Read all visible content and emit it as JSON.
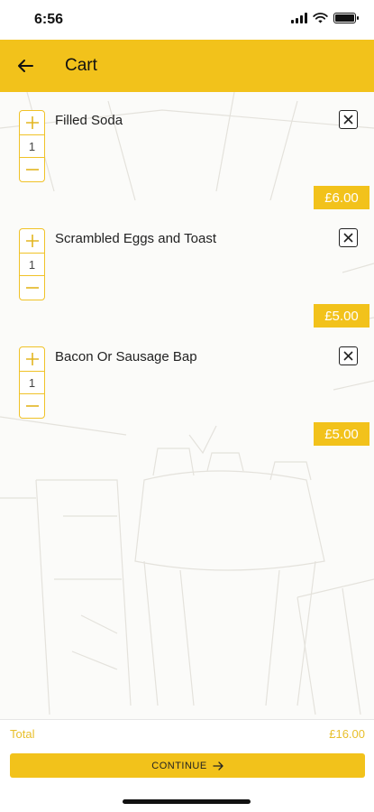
{
  "status_bar": {
    "time": "6:56"
  },
  "header": {
    "title": "Cart"
  },
  "cart": {
    "items": [
      {
        "name": "Filled Soda",
        "quantity": "1",
        "price": "£6.00"
      },
      {
        "name": "Scrambled Eggs and Toast",
        "quantity": "1",
        "price": "£5.00"
      },
      {
        "name": "Bacon Or Sausage Bap",
        "quantity": "1",
        "price": "£5.00"
      }
    ]
  },
  "footer": {
    "total_label": "Total",
    "total_value": "£16.00",
    "continue_label": "CONTINUE"
  },
  "colors": {
    "accent": "#f2c21b",
    "stepper_border": "#f0c227",
    "total_text": "#e8bf2a"
  },
  "icons": {
    "back": "arrow-left-icon",
    "increment": "plus-icon",
    "decrement": "minus-icon",
    "remove": "close-box-icon",
    "continue": "arrow-right-icon"
  }
}
